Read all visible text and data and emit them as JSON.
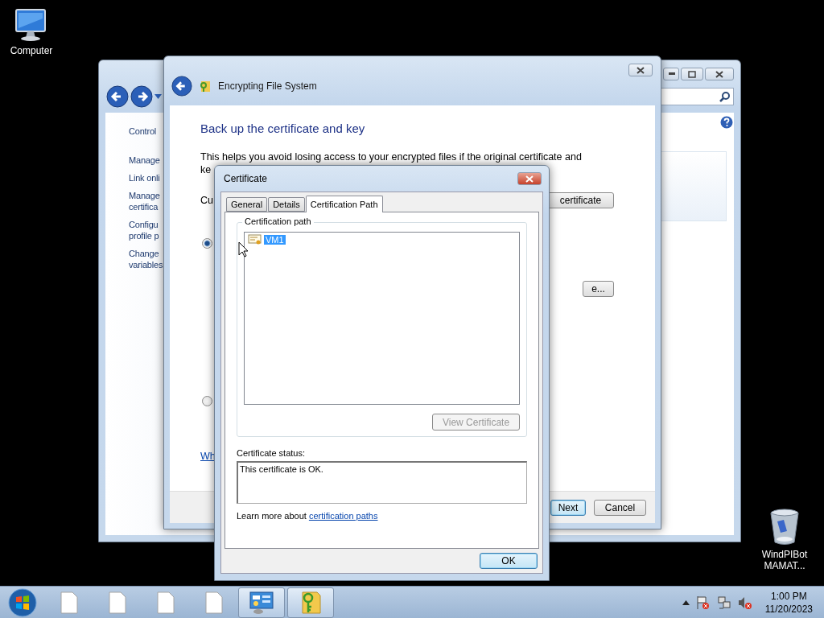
{
  "desktop_icons": [
    {
      "kind": "computer",
      "label": "Computer"
    },
    {
      "kind": "recycle_bin",
      "label": "WindPIBot MAMAT..."
    }
  ],
  "control_panel_window": {
    "sidebar_links": [
      "Control",
      "Manage",
      "Link onli",
      "Manage certifica",
      "Configu profile p",
      "Change variables"
    ]
  },
  "efs_wizard": {
    "title": "Encrypting File System",
    "heading": "Back up the certificate and key",
    "description": "This helps you avoid losing access to your encrypted files if the original certificate and",
    "description_continued": "ke",
    "option_label": "Cu",
    "options": [
      {
        "selected": true
      },
      {
        "selected": false
      }
    ],
    "option_buttons": [
      "certificate",
      "e..."
    ],
    "help_link": "Wh",
    "footer_buttons": [
      {
        "label": "Next",
        "kind": "default"
      },
      {
        "label": "Cancel",
        "kind": "normal"
      }
    ]
  },
  "certificate_dialog": {
    "title": "Certificate",
    "tabs": [
      {
        "label": "General",
        "selected": false
      },
      {
        "label": "Details",
        "selected": false
      },
      {
        "label": "Certification Path",
        "selected": true
      }
    ],
    "group_label": "Certification path",
    "tree": [
      {
        "label": "VM1",
        "selected": true
      }
    ],
    "view_button": {
      "label": "View Certificate",
      "disabled": true
    },
    "status_label": "Certificate status:",
    "status_text": "This certificate is OK.",
    "learn_more": "Learn more about ",
    "learn_more_link": "certification paths",
    "ok_button": "OK"
  },
  "taskbar": {
    "items": [
      {
        "kind": "document",
        "active": false
      },
      {
        "kind": "document",
        "active": false
      },
      {
        "kind": "document",
        "active": false
      },
      {
        "kind": "document",
        "active": false
      },
      {
        "kind": "control_panel",
        "active": true
      },
      {
        "kind": "key_folder",
        "active": true
      }
    ],
    "time": "1:00 PM",
    "date": "11/20/2023"
  }
}
